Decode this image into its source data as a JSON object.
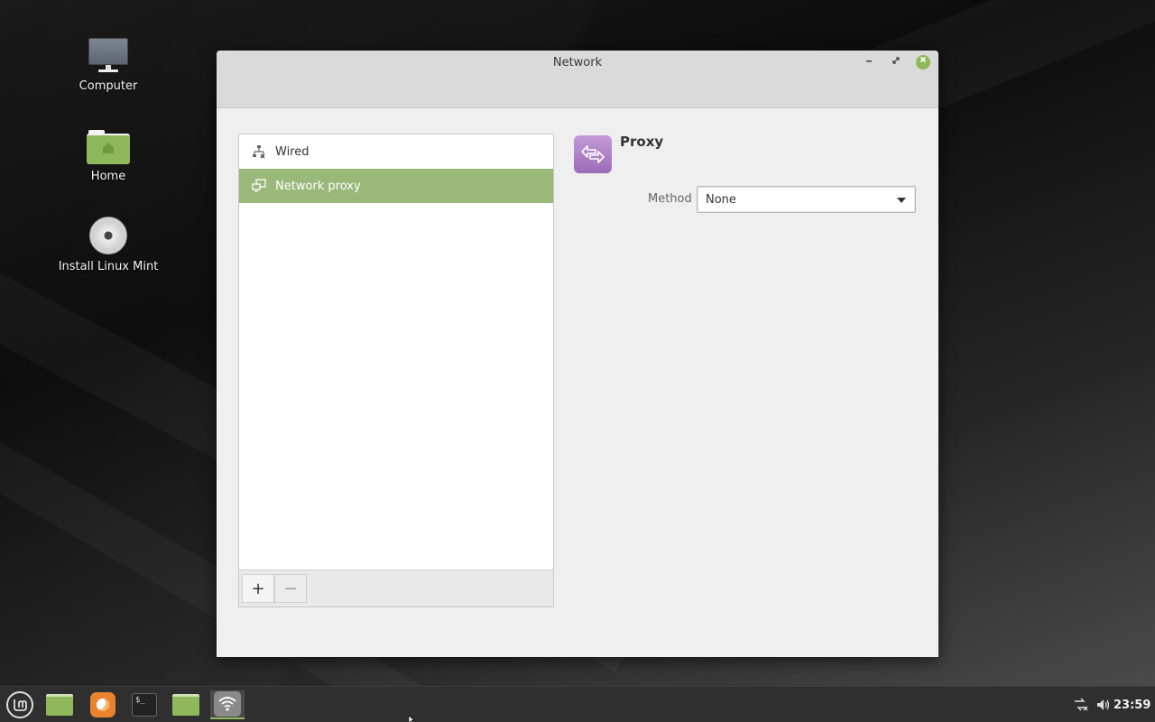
{
  "desktop": {
    "icons": [
      {
        "label": "Computer",
        "icon": "monitor-icon"
      },
      {
        "label": "Home",
        "icon": "home-folder-icon"
      },
      {
        "label": "Install Linux Mint",
        "icon": "disc-icon"
      }
    ]
  },
  "window": {
    "title": "Network",
    "controls": {
      "minimize": "minimize-icon",
      "maximize": "maximize-icon",
      "close": "close-icon"
    },
    "connections": [
      {
        "label": "Wired",
        "icon": "wired-network-icon",
        "selected": false
      },
      {
        "label": "Network proxy",
        "icon": "network-proxy-icon",
        "selected": true
      }
    ],
    "toolbar": {
      "add_label": "+",
      "remove_label": "−"
    },
    "detail": {
      "title": "Proxy",
      "icon": "proxy-arrows-icon",
      "method_label": "Method",
      "method_value": "None"
    }
  },
  "taskbar": {
    "apps": [
      "menu-icon",
      "show-desktop-icon",
      "firefox-icon",
      "terminal-icon",
      "files-icon",
      "network-settings-icon"
    ],
    "clock": "23:59",
    "terminal_glyph": "$_"
  },
  "colors": {
    "accent": "#9ab87a",
    "folder_green": "#8fb85a",
    "proxy_purple": "#b083c8",
    "window_bg": "#efefef",
    "taskbar_bg": "#2f2f2f"
  }
}
